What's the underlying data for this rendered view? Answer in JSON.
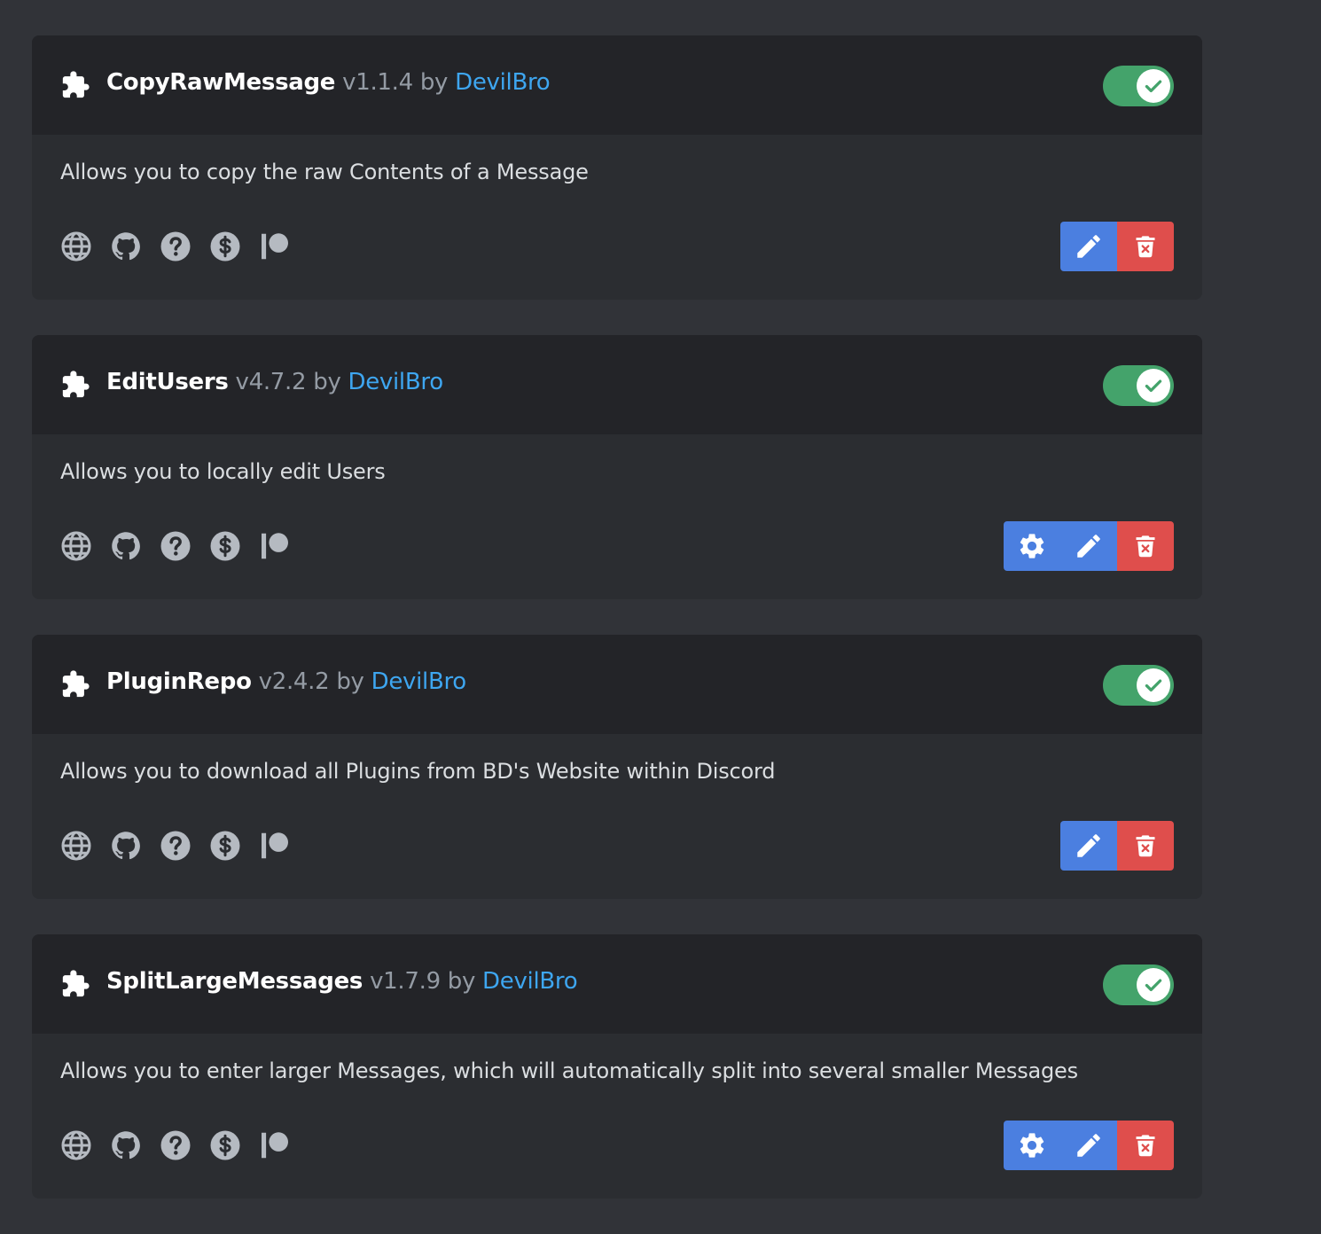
{
  "plugins": [
    {
      "name": "CopyRawMessage",
      "version": "v1.1.4",
      "by": "by",
      "author": "DevilBro",
      "description": "Allows you to copy the raw Contents of a Message",
      "enabled": true,
      "has_settings": false
    },
    {
      "name": "EditUsers",
      "version": "v4.7.2",
      "by": "by",
      "author": "DevilBro",
      "description": "Allows you to locally edit Users",
      "enabled": true,
      "has_settings": true
    },
    {
      "name": "PluginRepo",
      "version": "v2.4.2",
      "by": "by",
      "author": "DevilBro",
      "description": "Allows you to download all Plugins from BD's Website within Discord",
      "enabled": true,
      "has_settings": false
    },
    {
      "name": "SplitLargeMessages",
      "version": "v1.7.9",
      "by": "by",
      "author": "DevilBro",
      "description": "Allows you to enter larger Messages, which will automatically split into several smaller Messages",
      "enabled": true,
      "has_settings": true
    }
  ],
  "link_icons": [
    "globe-icon",
    "github-icon",
    "help-icon",
    "donate-icon",
    "patreon-icon"
  ],
  "colors": {
    "toggle_on": "#44a36b",
    "author_link": "#3ea6f0",
    "edit_button": "#4b7fe0",
    "delete_button": "#df4e4c"
  }
}
